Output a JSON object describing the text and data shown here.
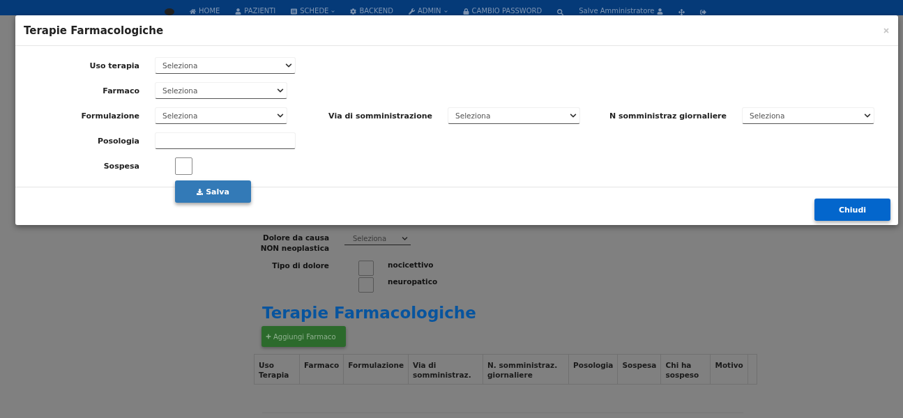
{
  "navbar": {
    "items": [
      {
        "kind": "home",
        "label": "HOME"
      },
      {
        "kind": "user",
        "label": "PAZIENTI"
      },
      {
        "kind": "list",
        "label": "SCHEDE",
        "dropdown": true
      },
      {
        "kind": "gear",
        "label": "BACKEND"
      },
      {
        "kind": "wrench",
        "label": "ADMIN",
        "dropdown": true
      },
      {
        "kind": "lock",
        "label": "CAMBIO PASSWORD"
      },
      {
        "kind": "search"
      },
      {
        "kind": "greeting",
        "label": "Salve Amministratore"
      },
      {
        "kind": "move"
      },
      {
        "kind": "logout"
      }
    ]
  },
  "page": {
    "pain_cause": {
      "label": "Dolore da causa NON neoplastica",
      "value": "Seleziona"
    },
    "pain_type": {
      "label": "Tipo di dolore",
      "options": [
        {
          "label": "nocicettivo",
          "checked": false
        },
        {
          "label": "neuropatico",
          "checked": false
        }
      ]
    },
    "heading": "Terapie Farmacologiche",
    "add_button": "Aggiungi Farmaco",
    "table": {
      "columns": [
        "Uso Terapia",
        "Farmaco",
        "Formulazione",
        "Via di somministraz.",
        "N. somministraz. giornaliere",
        "Posologia",
        "Sospesa",
        "Chi ha sospeso",
        "Motivo"
      ]
    }
  },
  "modal": {
    "title": "Terapie Farmacologiche",
    "rows": [
      [
        {
          "kind": "select",
          "label": "Uso terapia",
          "value": "Seleziona"
        }
      ],
      [
        {
          "kind": "select",
          "label": "Farmaco",
          "value": "Seleziona"
        }
      ],
      [
        {
          "kind": "select",
          "label": "Formulazione",
          "value": "Seleziona"
        },
        {
          "kind": "select",
          "label": "Via di somministrazione",
          "value": "Seleziona"
        },
        {
          "kind": "select",
          "label": "N somministraz giornaliere",
          "value": "Seleziona"
        }
      ],
      [
        {
          "kind": "text",
          "label": "Posologia"
        }
      ],
      [
        {
          "kind": "checkbox",
          "label": "Sospesa",
          "checked": false
        }
      ]
    ],
    "save_button": "Salva",
    "close_button": "Chiudi"
  }
}
